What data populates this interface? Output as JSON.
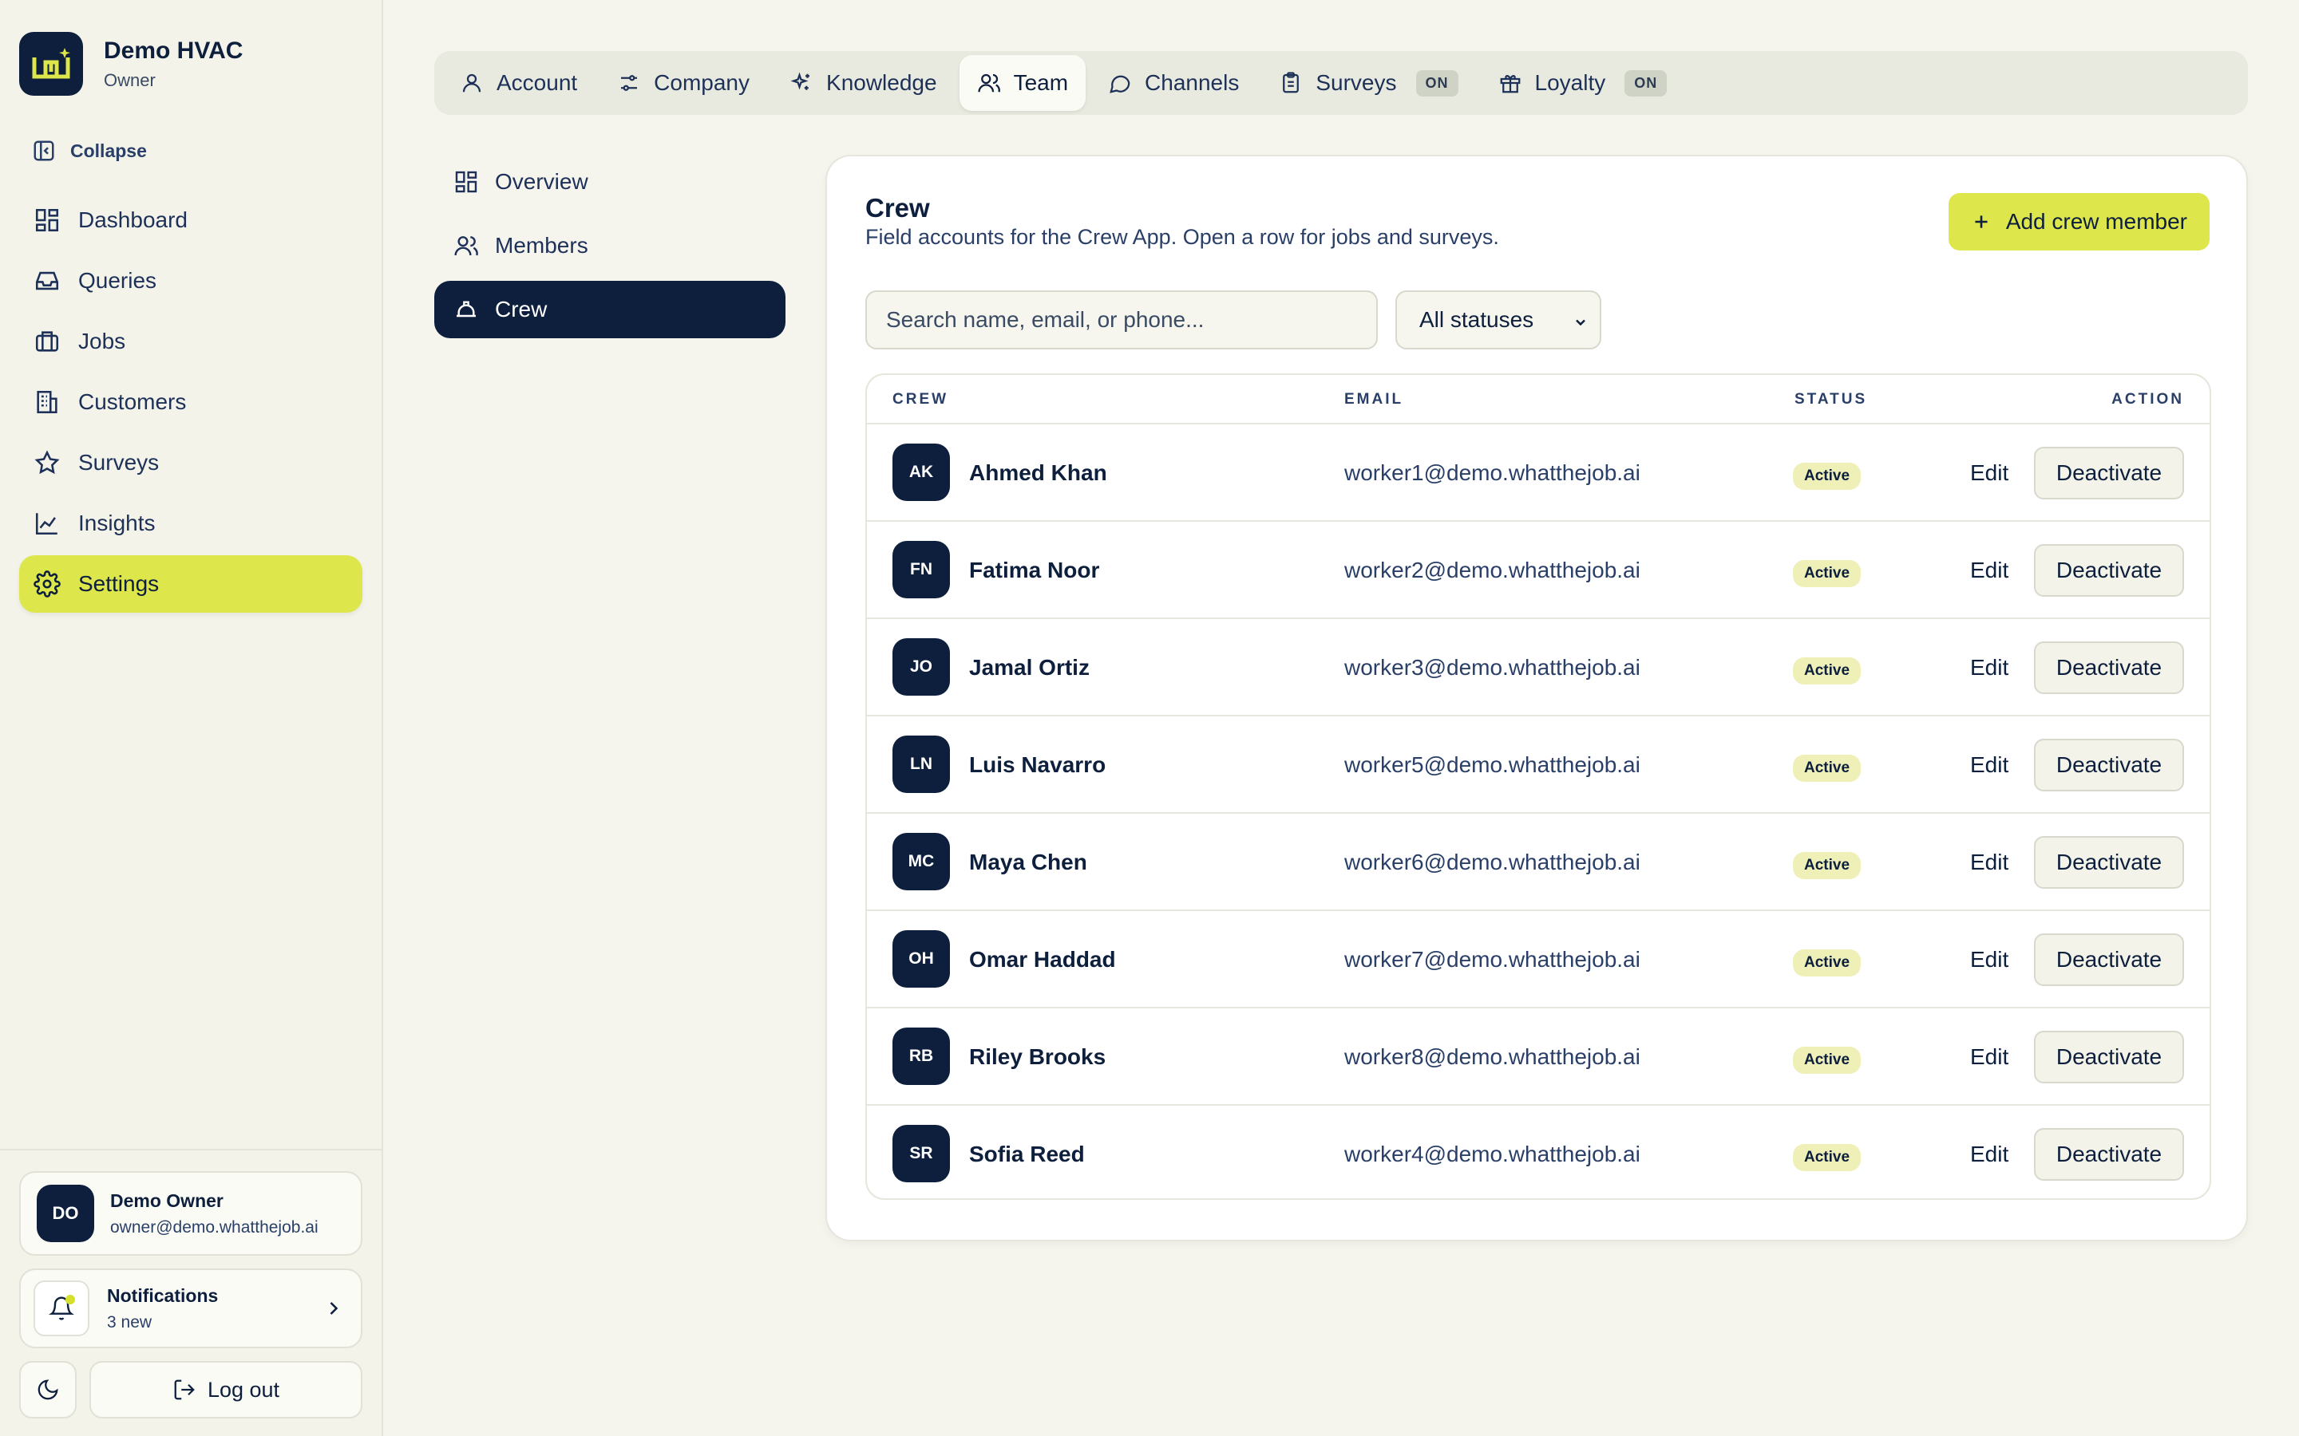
{
  "sidebar": {
    "brand_name": "Demo HVAC",
    "brand_role": "Owner",
    "collapse_label": "Collapse",
    "items": [
      {
        "label": "Dashboard",
        "icon": "dashboard-icon"
      },
      {
        "label": "Queries",
        "icon": "inbox-icon"
      },
      {
        "label": "Jobs",
        "icon": "briefcase-icon"
      },
      {
        "label": "Customers",
        "icon": "building-icon"
      },
      {
        "label": "Surveys",
        "icon": "star-icon"
      },
      {
        "label": "Insights",
        "icon": "chart-icon"
      },
      {
        "label": "Settings",
        "icon": "gear-icon",
        "active": true
      }
    ],
    "user": {
      "initials": "DO",
      "name": "Demo Owner",
      "email": "owner@demo.whatthejob.ai"
    },
    "notifications": {
      "title": "Notifications",
      "subtitle": "3 new"
    },
    "logout_label": "Log out"
  },
  "tabs": [
    {
      "label": "Account",
      "icon": "user-icon"
    },
    {
      "label": "Company",
      "icon": "sliders-icon"
    },
    {
      "label": "Knowledge",
      "icon": "sparkles-icon"
    },
    {
      "label": "Team",
      "icon": "users-icon",
      "active": true
    },
    {
      "label": "Channels",
      "icon": "chat-icon"
    },
    {
      "label": "Surveys",
      "icon": "clipboard-icon",
      "badge": "ON"
    },
    {
      "label": "Loyalty",
      "icon": "gift-icon",
      "badge": "ON"
    }
  ],
  "subnav": [
    {
      "label": "Overview",
      "icon": "grid-icon"
    },
    {
      "label": "Members",
      "icon": "users-icon"
    },
    {
      "label": "Crew",
      "icon": "hardhat-icon",
      "active": true
    }
  ],
  "crew": {
    "title": "Crew",
    "subtitle": "Field accounts for the Crew App. Open a row for jobs and surveys.",
    "add_label": "Add crew member",
    "search_placeholder": "Search name, email, or phone...",
    "status_filter": "All statuses",
    "columns": {
      "crew": "CREW",
      "email": "EMAIL",
      "status": "STATUS",
      "action": "ACTION"
    },
    "edit_label": "Edit",
    "deactivate_label": "Deactivate",
    "rows": [
      {
        "initials": "AK",
        "name": "Ahmed Khan",
        "email": "worker1@demo.whatthejob.ai",
        "status": "Active"
      },
      {
        "initials": "FN",
        "name": "Fatima Noor",
        "email": "worker2@demo.whatthejob.ai",
        "status": "Active"
      },
      {
        "initials": "JO",
        "name": "Jamal Ortiz",
        "email": "worker3@demo.whatthejob.ai",
        "status": "Active"
      },
      {
        "initials": "LN",
        "name": "Luis Navarro",
        "email": "worker5@demo.whatthejob.ai",
        "status": "Active"
      },
      {
        "initials": "MC",
        "name": "Maya Chen",
        "email": "worker6@demo.whatthejob.ai",
        "status": "Active"
      },
      {
        "initials": "OH",
        "name": "Omar Haddad",
        "email": "worker7@demo.whatthejob.ai",
        "status": "Active"
      },
      {
        "initials": "RB",
        "name": "Riley Brooks",
        "email": "worker8@demo.whatthejob.ai",
        "status": "Active"
      },
      {
        "initials": "SR",
        "name": "Sofia Reed",
        "email": "worker4@demo.whatthejob.ai",
        "status": "Active"
      }
    ]
  },
  "colors": {
    "accent": "#dde64a",
    "navy": "#0d1f3c",
    "background": "#f5f5ee"
  }
}
